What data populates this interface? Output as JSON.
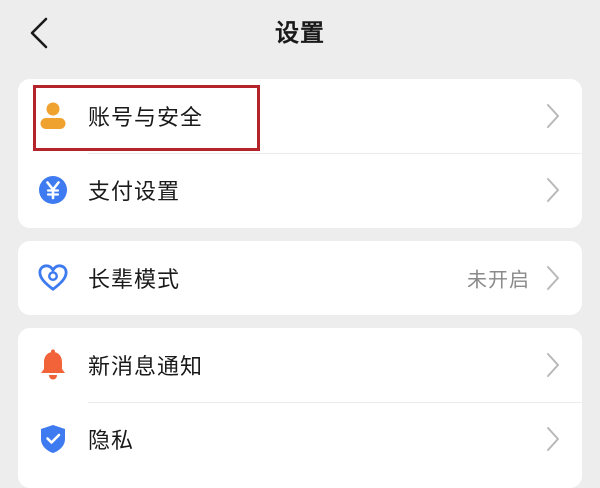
{
  "header": {
    "title": "设置",
    "back_icon": "chevron-left-icon"
  },
  "groups": [
    {
      "items": [
        {
          "label": "账号与安全",
          "icon": "person-icon",
          "icon_color": "#f0a22e",
          "value": ""
        },
        {
          "label": "支付设置",
          "icon": "yuan-icon",
          "icon_color": "#3e7bf0",
          "value": ""
        }
      ]
    },
    {
      "items": [
        {
          "label": "长辈模式",
          "icon": "heart-icon",
          "icon_color": "#3e7bf0",
          "value": "未开启"
        }
      ]
    },
    {
      "items": [
        {
          "label": "新消息通知",
          "icon": "bell-icon",
          "icon_color": "#f2633a",
          "value": ""
        },
        {
          "label": "隐私",
          "icon": "shield-check-icon",
          "icon_color": "#3e7bf0",
          "value": ""
        }
      ]
    }
  ],
  "chevron_icon": "chevron-right-icon",
  "highlight_color": "#b3252a"
}
